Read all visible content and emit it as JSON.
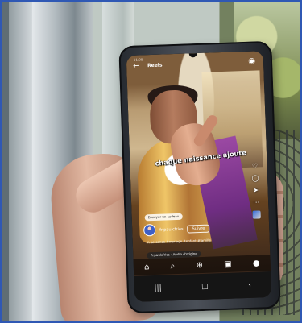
{
  "scene": {
    "accent_border": "#2f58b4"
  },
  "phone": {
    "status_time": "11:09",
    "title": "Reels",
    "back_icon": "arrow-left-icon",
    "camera_icon": "camera-icon",
    "caption_overlay": "chaque naissance ajoute",
    "remix_chip": "Envoyer un cadeau",
    "username": "fr.paulcfries",
    "follow_label": "Suivre",
    "description": "#naissance #mariage #enfant #famille",
    "audio": "fr.paulcfries · Audio d'origine",
    "side_counts": {
      "likes": "",
      "comments": "",
      "shares": ""
    },
    "nav_icons": [
      "home-icon",
      "search-icon",
      "plus-icon",
      "reels-icon",
      "profile-icon"
    ],
    "system_icons": [
      "recent-apps-icon",
      "home-button-icon",
      "back-button-icon"
    ]
  }
}
